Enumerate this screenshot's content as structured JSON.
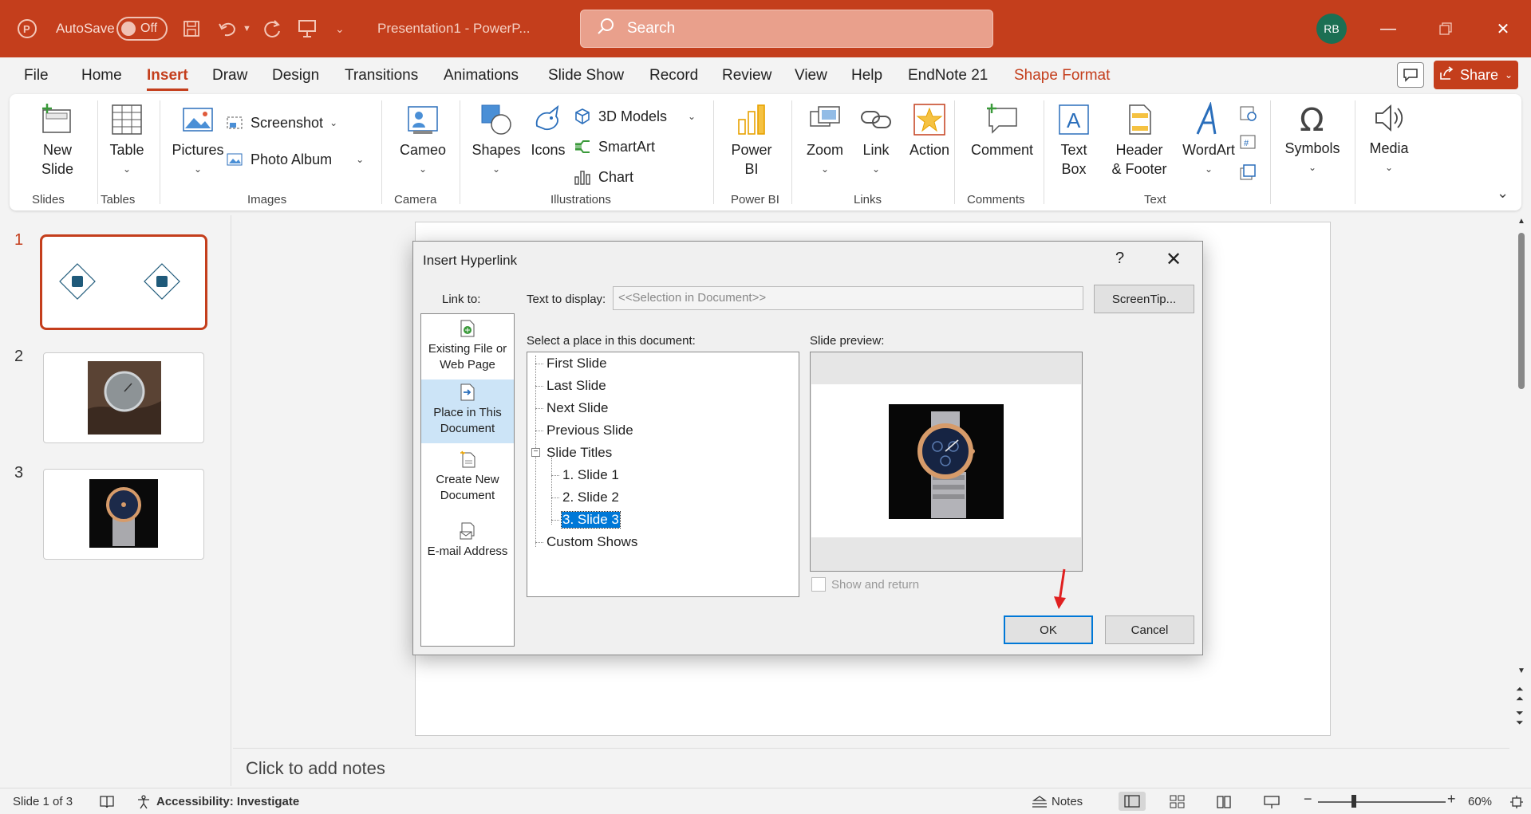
{
  "titlebar": {
    "autosave_label": "AutoSave",
    "autosave_state": "Off",
    "doc_title": "Presentation1  -  PowerP...",
    "search_placeholder": "Search",
    "user_initials": "RB"
  },
  "menu": {
    "tabs": [
      "File",
      "Home",
      "Insert",
      "Draw",
      "Design",
      "Transitions",
      "Animations",
      "Slide Show",
      "Record",
      "Review",
      "View",
      "Help",
      "EndNote 21",
      "Shape Format"
    ],
    "active_tab": "Insert",
    "share_label": "Share"
  },
  "ribbon": {
    "new_slide": "New\nSlide",
    "table": "Table",
    "pictures": "Pictures",
    "screenshot": "Screenshot",
    "photo_album": "Photo Album",
    "cameo": "Cameo",
    "shapes": "Shapes",
    "icons": "Icons",
    "models_3d": "3D Models",
    "smartart": "SmartArt",
    "chart": "Chart",
    "power_bi": "Power\nBI",
    "zoom": "Zoom",
    "link": "Link",
    "action": "Action",
    "comment": "Comment",
    "text_box": "Text\nBox",
    "header_footer": "Header\n& Footer",
    "wordart": "WordArt",
    "symbols": "Symbols",
    "media": "Media",
    "groups": {
      "slides": "Slides",
      "tables": "Tables",
      "images": "Images",
      "camera": "Camera",
      "illustrations": "Illustrations",
      "power_bi": "Power BI",
      "links": "Links",
      "comments": "Comments",
      "text": "Text"
    }
  },
  "slides": {
    "numbers": [
      "1",
      "2",
      "3"
    ],
    "selected": 1
  },
  "notes_placeholder": "Click to add notes",
  "status": {
    "slide_info": "Slide 1 of 3",
    "accessibility": "Accessibility: Investigate",
    "notes": "Notes",
    "zoom": "60%"
  },
  "dialog": {
    "title": "Insert Hyperlink",
    "help": "?",
    "link_to_label": "Link to:",
    "text_to_display_label": "Text to display:",
    "text_to_display_value": "<<Selection in Document>>",
    "screentip_button": "ScreenTip...",
    "select_place_label": "Select a place in this document:",
    "slide_preview_label": "Slide preview:",
    "link_options": {
      "existing": "Existing File or\nWeb Page",
      "place": "Place in This\nDocument",
      "create_new": "Create New\nDocument",
      "email": "E-mail Address"
    },
    "tree": {
      "first": "First Slide",
      "last": "Last Slide",
      "next": "Next Slide",
      "previous": "Previous Slide",
      "slide_titles": "Slide Titles",
      "slide1": "1. Slide 1",
      "slide2": "2. Slide 2",
      "slide3": "3. Slide 3",
      "custom_shows": "Custom Shows"
    },
    "selected_item": "3. Slide 3",
    "show_and_return": "Show and return",
    "show_and_return_checked": false,
    "ok_button": "OK",
    "cancel_button": "Cancel"
  },
  "colors": {
    "accent": "#c43e1c",
    "selection": "#0078d7",
    "link_selected_bg": "#cce4f7",
    "avatar": "#1b6f53"
  }
}
